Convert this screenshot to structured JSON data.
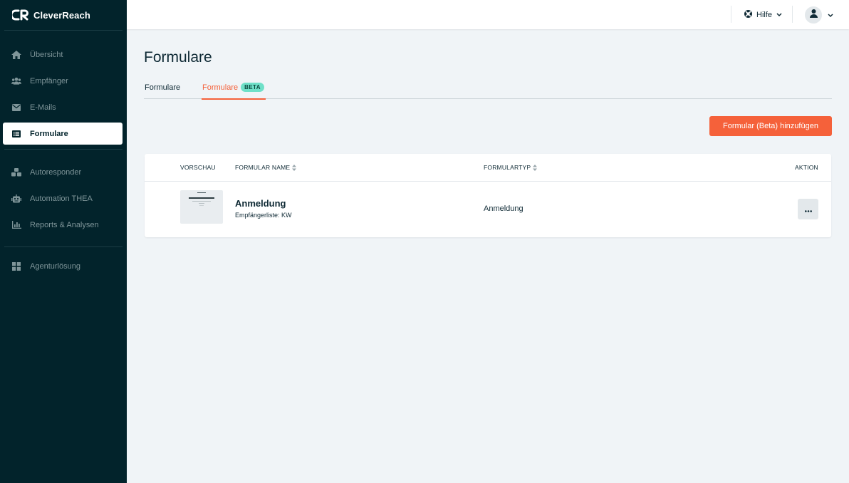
{
  "brand": {
    "name": "CleverReach"
  },
  "sidebar": {
    "group1": [
      {
        "label": "Übersicht",
        "icon": "home-icon"
      },
      {
        "label": "Empfänger",
        "icon": "users-icon"
      },
      {
        "label": "E-Mails",
        "icon": "envelope-icon"
      },
      {
        "label": "Formulare",
        "icon": "list-icon",
        "active": true
      }
    ],
    "group2": [
      {
        "label": "Autoresponder",
        "icon": "cubes-icon"
      },
      {
        "label": "Automation THEA",
        "icon": "robot-icon"
      },
      {
        "label": "Reports & Analysen",
        "icon": "chart-icon"
      }
    ],
    "group3": [
      {
        "label": "Agenturlösung",
        "icon": "grid-icon"
      }
    ]
  },
  "topbar": {
    "help_label": "Hilfe",
    "help_icon": "lifebuoy-icon",
    "user_icon": "user-icon"
  },
  "main": {
    "title": "Formulare",
    "tabs": [
      {
        "label": "Formulare",
        "active": false
      },
      {
        "label": "Formulare",
        "badge": "BETA",
        "active": true
      }
    ],
    "add_button_label": "Formular (Beta) hinzufügen"
  },
  "table": {
    "headers": {
      "preview": "VORSCHAU",
      "name": "FORMULAR NAME",
      "type": "FORMULARTYP",
      "action": "AKTION"
    },
    "rows": [
      {
        "name": "Anmeldung",
        "list": "Empfängerliste: KW",
        "type": "Anmeldung"
      }
    ]
  },
  "colors": {
    "sidebar_bg": "#02232b",
    "accent": "#f5613a",
    "beta_badge": "#6fe0c8",
    "page_bg": "#f0f4f7"
  }
}
